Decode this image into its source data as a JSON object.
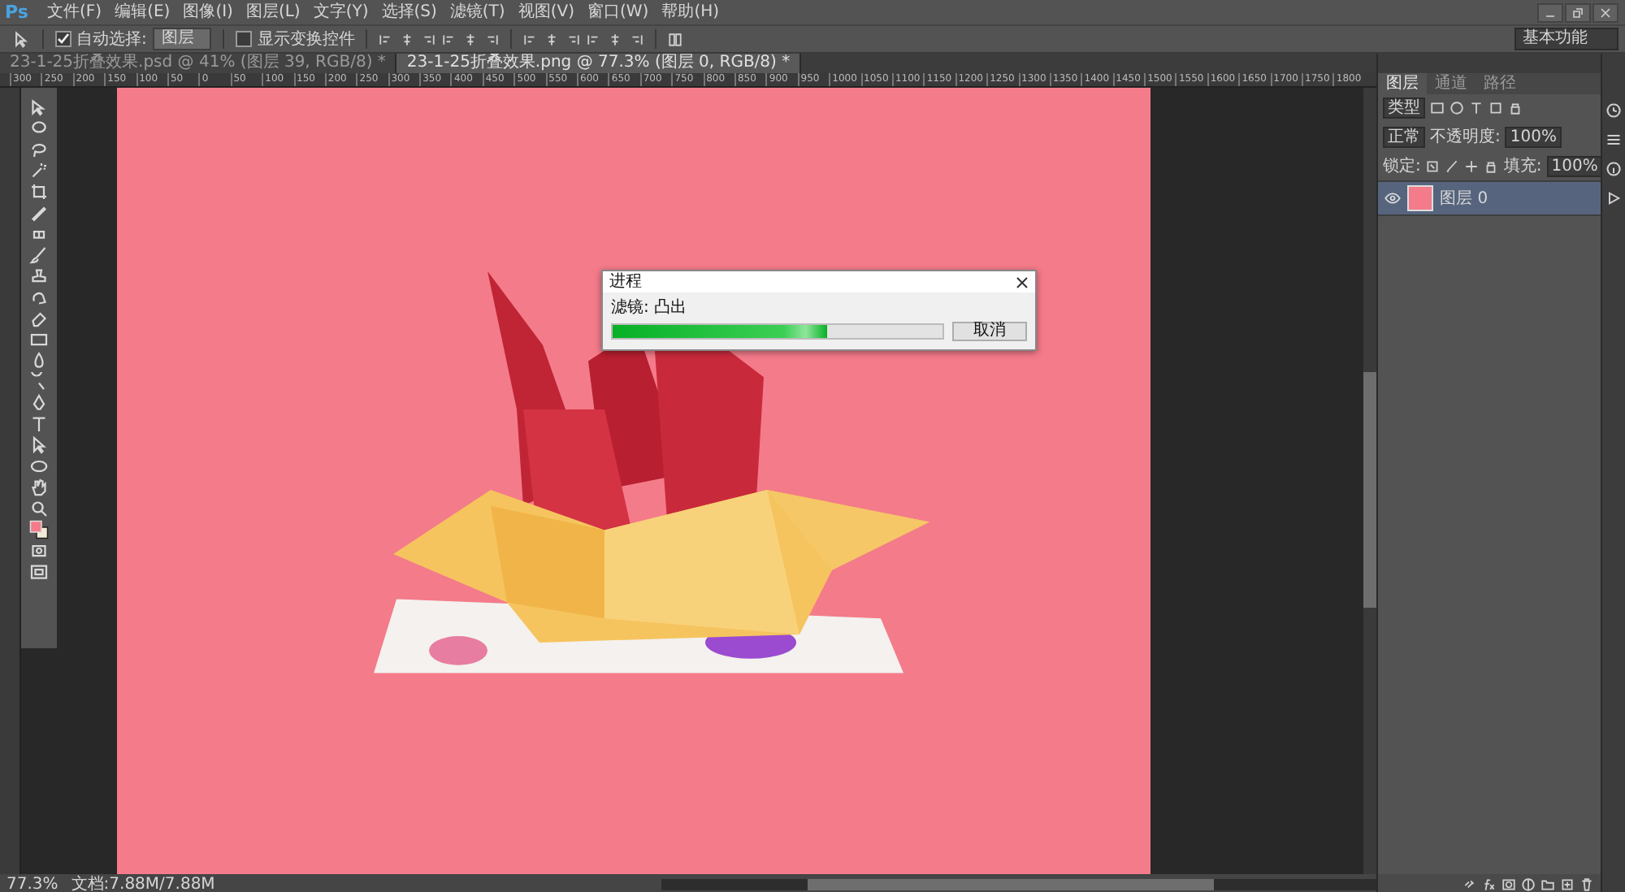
{
  "app_logo": "Ps",
  "menu": [
    "文件(F)",
    "编辑(E)",
    "图像(I)",
    "图层(L)",
    "文字(Y)",
    "选择(S)",
    "滤镜(T)",
    "视图(V)",
    "窗口(W)",
    "帮助(H)"
  ],
  "options_bar": {
    "auto_select": {
      "label": "自动选择:",
      "checked": true
    },
    "auto_select_target": "图层",
    "show_transform": {
      "label": "显示变换控件",
      "checked": false
    },
    "workspace": "基本功能"
  },
  "doc_tabs": [
    {
      "label": "23-1-25折叠效果.psd @ 41% (图层 39, RGB/8) *",
      "selected": false
    },
    {
      "label": "23-1-25折叠效果.png @ 77.3% (图层 0, RGB/8) *",
      "selected": true
    }
  ],
  "ruler": [
    "300",
    "250",
    "200",
    "150",
    "100",
    "50",
    "0",
    "50",
    "100",
    "150",
    "200",
    "250",
    "300",
    "350",
    "400",
    "450",
    "500",
    "550",
    "600",
    "650",
    "700",
    "750",
    "800",
    "850",
    "900",
    "950",
    "1000",
    "1050",
    "1100",
    "1150",
    "1200",
    "1250",
    "1300",
    "1350",
    "1400",
    "1450",
    "1500",
    "1550",
    "1600",
    "1650",
    "1700",
    "1750",
    "1800"
  ],
  "progress_dialog": {
    "title": "进程",
    "message": "滤镜: 凸出",
    "level": 0.65,
    "button": "取消"
  },
  "status_bar": {
    "zoom": "77.3%",
    "doc": "文档:7.88M/7.88M"
  },
  "layers_panel": {
    "tabs": [
      {
        "label": "图层",
        "selected": true
      },
      {
        "label": "通道",
        "selected": false
      },
      {
        "label": "路径",
        "selected": false
      }
    ],
    "filter": "类型",
    "blend_mode": "正常",
    "opacity_label": "不透明度:",
    "opacity": "100%",
    "lock_label": "锁定:",
    "fill_label": "填充:",
    "fill": "100%",
    "layers": [
      {
        "name": "图层 0",
        "visible": true,
        "selected": true
      }
    ]
  }
}
